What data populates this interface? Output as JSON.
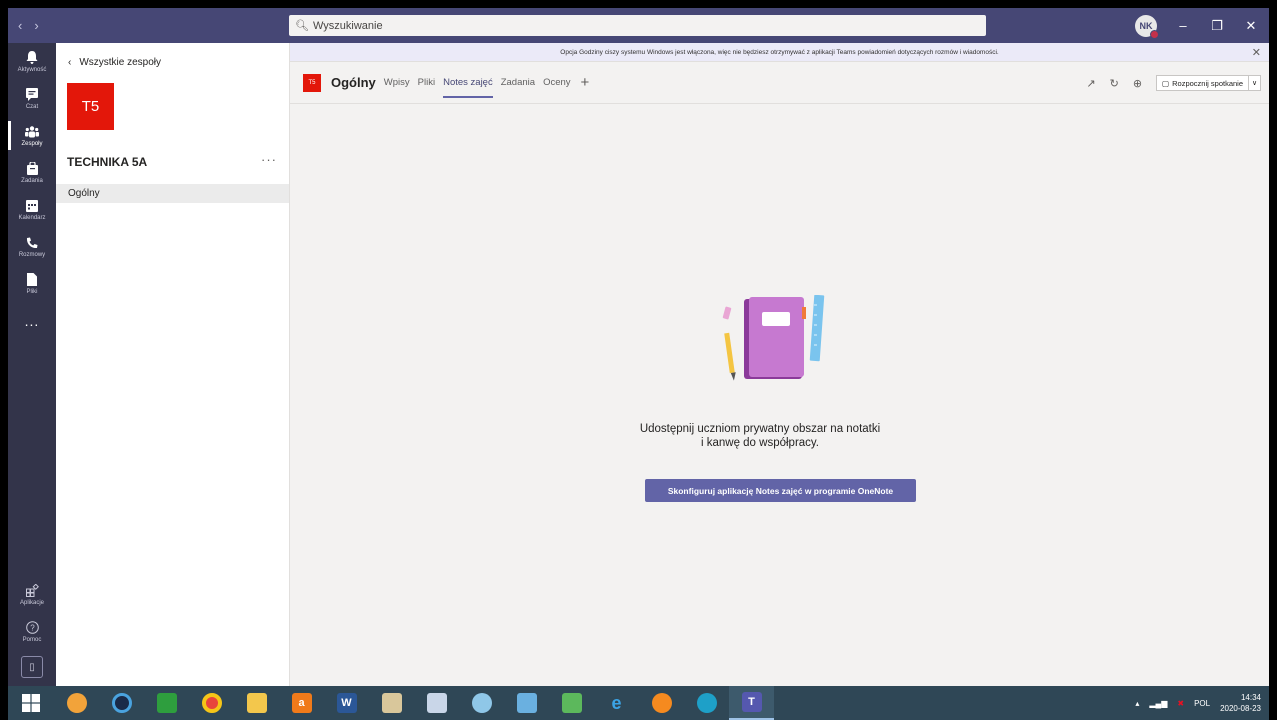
{
  "titlebar": {
    "search_placeholder": "Wyszukiwanie",
    "avatar_initials": "NK"
  },
  "rail": {
    "items": [
      {
        "label": "Aktywność",
        "icon": "bell-icon"
      },
      {
        "label": "Czat",
        "icon": "chat-icon"
      },
      {
        "label": "Zespoły",
        "icon": "teams-icon"
      },
      {
        "label": "Zadania",
        "icon": "assignments-icon"
      },
      {
        "label": "Kalendarz",
        "icon": "calendar-icon"
      },
      {
        "label": "Rozmowy",
        "icon": "phone-icon"
      },
      {
        "label": "Pliki",
        "icon": "file-icon"
      }
    ],
    "more": "...",
    "bottom": [
      {
        "label": "Aplikacje",
        "icon": "apps-icon"
      },
      {
        "label": "Pomoc",
        "icon": "help-icon"
      }
    ]
  },
  "teampanel": {
    "back_label": "Wszystkie zespoły",
    "team_initials": "T5",
    "team_name": "TECHNIKA 5A",
    "more": "···",
    "channel": "Ogólny"
  },
  "main": {
    "banner": "Opcja Godziny ciszy systemu Windows jest włączona, więc nie będziesz otrzymywać z aplikacji Teams powiadomień dotyczących rozmów i wiadomości.",
    "channel_badge": "T5",
    "channel_title": "Ogólny",
    "tabs": [
      "Wpisy",
      "Pliki",
      "Notes zajęć",
      "Zadania",
      "Oceny"
    ],
    "active_tab": "Notes zajęć",
    "meet_label": "Rozpocznij spotkanie",
    "empty_line1": "Udostępnij uczniom prywatny obszar na notatki",
    "empty_line2": "i kanwę do współpracy.",
    "configure_button": "Skonfiguruj aplikację Notes zajęć w programie OneNote"
  },
  "taskbar": {
    "lang": "POL",
    "time": "14:34",
    "date": "2020-08-23"
  },
  "colors": {
    "titlebar": "#464775",
    "rail": "#33344a",
    "accent": "#6264a7",
    "team_tile": "#e3170a"
  }
}
